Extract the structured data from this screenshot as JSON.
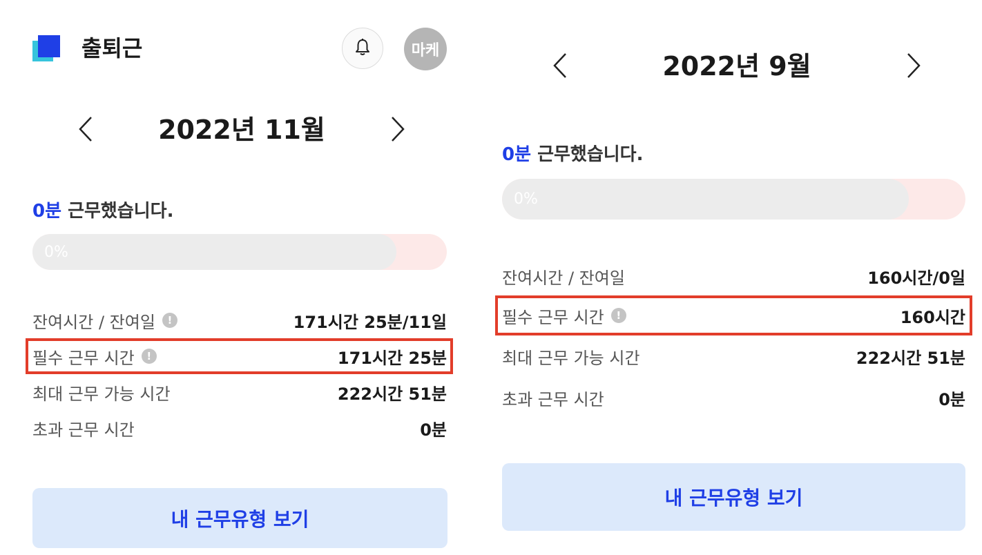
{
  "left": {
    "header": {
      "app_title": "출퇴근",
      "avatar_text": "마케"
    },
    "month_nav": {
      "title": "2022년 11월"
    },
    "summary": {
      "worked_value": "0분",
      "worked_suffix": " 근무했습니다.",
      "progress_text": "0%",
      "progress_fraction": 0
    },
    "stats": [
      {
        "label": "잔여시간 / 잔여일",
        "value": "171시간 25분/11일"
      },
      {
        "label": "필수 근무 시간",
        "value": "171시간 25분"
      },
      {
        "label": "최대 근무 가능 시간",
        "value": "222시간 51분"
      },
      {
        "label": "초과 근무 시간",
        "value": "0분"
      }
    ],
    "cta_label": "내 근무유형 보기"
  },
  "right": {
    "month_nav": {
      "title": "2022년 9월"
    },
    "summary": {
      "worked_value": "0분",
      "worked_suffix": " 근무했습니다.",
      "progress_text": "0%",
      "progress_fraction": 0
    },
    "stats": [
      {
        "label": "잔여시간 / 잔여일",
        "value": "160시간/0일"
      },
      {
        "label": "필수 근무 시간",
        "value": "160시간"
      },
      {
        "label": "최대 근무 가능 시간",
        "value": "222시간 51분"
      },
      {
        "label": "초과 근무 시간",
        "value": "0분"
      }
    ],
    "cta_label": "내 근무유형 보기"
  },
  "icons": {
    "info": "!",
    "bell": "bell-icon",
    "prev": "chevron-left-icon",
    "next": "chevron-right-icon"
  },
  "colors": {
    "brand_blue": "#1f3fe6",
    "brand_cyan": "#36c4dc",
    "highlight_red": "#e23d2a",
    "cta_bg": "#dce9fb",
    "progress_track": "#fde9e8",
    "progress_fill": "#ececec"
  }
}
